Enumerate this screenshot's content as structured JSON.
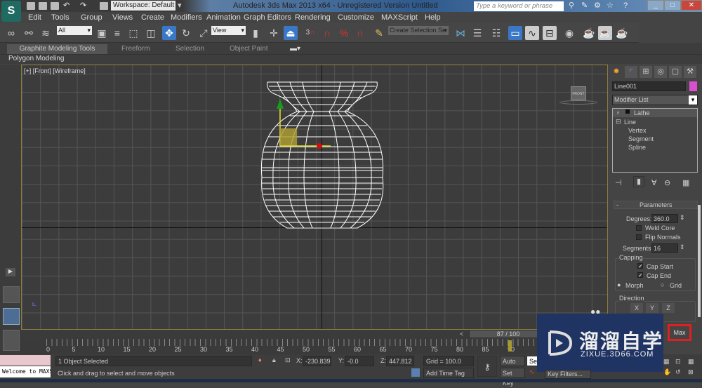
{
  "titlebar": {
    "workspace": "Workspace: Default",
    "title": "Autodesk 3ds Max  2013 x64   -  Unregistered Version    Untitled",
    "search_placeholder": "Type a keyword or phrase",
    "logo": "S"
  },
  "menu": [
    "Edit",
    "Tools",
    "Group",
    "Views",
    "Create",
    "Modifiers",
    "Animation",
    "Graph Editors",
    "Rendering",
    "Customize",
    "MAXScript",
    "Help"
  ],
  "toolbar": {
    "selection_filter": "All",
    "ref_coord": "View",
    "named_selection": "Create Selection Se",
    "snap_label": "3"
  },
  "ribbon": {
    "tabs": [
      "Graphite Modeling Tools",
      "Freeform",
      "Selection",
      "Object Paint"
    ],
    "subpanel": "Polygon Modeling"
  },
  "viewport": {
    "label": "[+] [Front] [Wireframe]",
    "viewcube": "FRONT"
  },
  "command_panel": {
    "object_name": "Line001",
    "object_color": "#d94fd0",
    "modifier_list": "Modifier List",
    "stack": [
      "Lathe",
      "Line",
      "Vertex",
      "Segment",
      "Spline"
    ],
    "rollout": "Parameters",
    "degrees_label": "Degrees:",
    "degrees": "360.0",
    "weld_core": "Weld Core",
    "flip_normals": "Flip Normals",
    "segments_label": "Segments:",
    "segments": "16",
    "capping": "Capping",
    "cap_start": "Cap Start",
    "cap_end": "Cap End",
    "morph": "Morph",
    "grid": "Grid",
    "direction": "Direction",
    "axes": [
      "X",
      "Y",
      "Z"
    ],
    "max_btn": "Max"
  },
  "timeline": {
    "slider": "87 / 100",
    "current_frame": 87,
    "ticks": [
      "0",
      "5",
      "10",
      "15",
      "20",
      "25",
      "30",
      "35",
      "40",
      "45",
      "50",
      "55",
      "60",
      "65",
      "70",
      "75",
      "80",
      "85",
      "90"
    ]
  },
  "status": {
    "maxscript": "Welcome to MAXS",
    "selected": "1 Object Selected",
    "prompt": "Click and drag to select and move objects",
    "x_label": "X:",
    "x": "-230.839",
    "y_label": "Y:",
    "y": "-0.0",
    "z_label": "Z:",
    "z": "447.812",
    "grid": "Grid = 100.0",
    "add_time_tag": "Add Time Tag",
    "auto_key": "Auto Key",
    "set_key": "Set Key",
    "selected_dd": "Sele",
    "key_filters": "Key Filters..."
  },
  "watermark": {
    "cn": "溜溜自学",
    "url": "ZIXUE.3D66.COM"
  }
}
